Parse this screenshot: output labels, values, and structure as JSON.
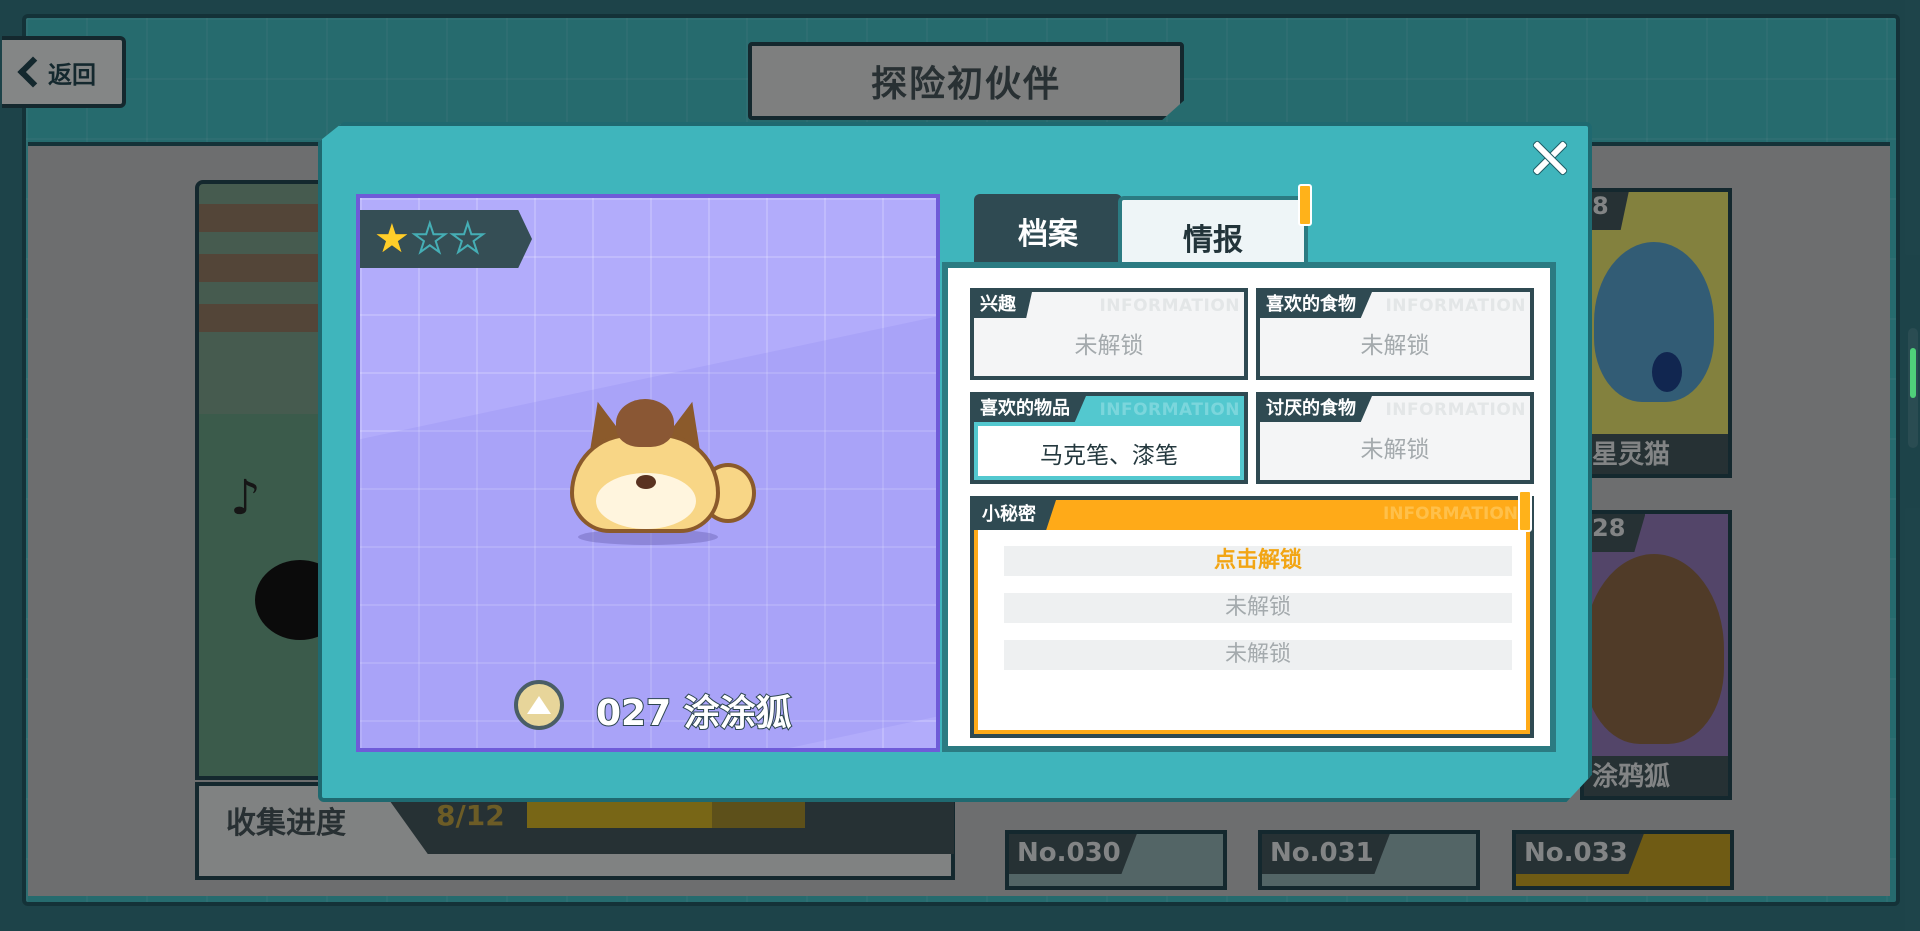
{
  "header": {
    "back_label": "返回",
    "title": "探险初伙伴"
  },
  "background": {
    "progress_label": "收集进度",
    "progress_count": "8/12",
    "progress_fraction": 0.667,
    "cards": [
      {
        "number": "8",
        "name": "星灵猫"
      },
      {
        "number": "28",
        "name": "涂鸦狐"
      }
    ],
    "bottom_tiles": [
      "No.030",
      "No.031",
      "No.033"
    ]
  },
  "modal": {
    "stars_filled": 1,
    "stars_total": 3,
    "pet_name": "027 涂涂狐",
    "tabs": [
      {
        "label": "档案",
        "active": false
      },
      {
        "label": "情报",
        "active": true
      }
    ],
    "watermark": "INFORMATION",
    "info": {
      "hobby": {
        "title": "兴趣",
        "value": "未解锁"
      },
      "fav_food": {
        "title": "喜欢的食物",
        "value": "未解锁"
      },
      "fav_item": {
        "title": "喜欢的物品",
        "value": "马克笔、漆笔"
      },
      "disliked_food": {
        "title": "讨厌的食物",
        "value": "未解锁"
      }
    },
    "secret": {
      "title": "小秘密",
      "lines": [
        "点击解锁",
        "未解锁",
        "未解锁"
      ]
    }
  },
  "colors": {
    "modal_teal": "#3fb5bc",
    "portrait_lavender": "#b2acfb",
    "accent_orange": "#ffaa18",
    "star_gold": "#ffce2a"
  }
}
